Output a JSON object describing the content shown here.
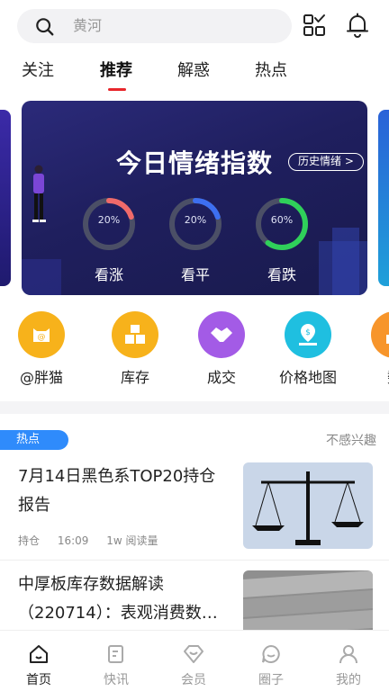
{
  "search": {
    "placeholder": "黄河"
  },
  "tabs": [
    {
      "label": "关注"
    },
    {
      "label": "推荐",
      "active": true
    },
    {
      "label": "解惑"
    },
    {
      "label": "热点"
    }
  ],
  "banner": {
    "title": "今日情绪指数",
    "history_button": "历史情绪 >",
    "gauges": [
      {
        "label": "看涨",
        "value": "20%",
        "fraction": 0.2,
        "color": "#f06a6a"
      },
      {
        "label": "看平",
        "value": "20%",
        "fraction": 0.2,
        "color": "#3d6ff0"
      },
      {
        "label": "看跌",
        "value": "60%",
        "fraction": 0.6,
        "color": "#2fd05a"
      }
    ]
  },
  "quick_links": [
    {
      "label": "@胖猫",
      "icon": "cat-icon",
      "color": "#f7b21b"
    },
    {
      "label": "库存",
      "icon": "boxes-icon",
      "color": "#f7b21b"
    },
    {
      "label": "成交",
      "icon": "handshake-icon",
      "color": "#a35be6"
    },
    {
      "label": "价格地图",
      "icon": "map-pin-icon",
      "color": "#1fbfe0"
    },
    {
      "label": "数",
      "icon": "data-icon",
      "color": "#f7952b"
    }
  ],
  "feed": {
    "section_tag": "热点",
    "not_interested": "不感兴趣",
    "articles": [
      {
        "title": "7月14日黑色系TOP20持仓报告",
        "tag": "持仓",
        "time": "16:09",
        "reads": "1w 阅读量"
      },
      {
        "title": "中厚板库存数据解读（220714）：表观消费数…"
      }
    ]
  },
  "bottom_nav": [
    {
      "label": "首页",
      "icon": "home-icon",
      "active": true
    },
    {
      "label": "快讯",
      "icon": "news-icon"
    },
    {
      "label": "会员",
      "icon": "member-icon"
    },
    {
      "label": "圈子",
      "icon": "circle-chat-icon"
    },
    {
      "label": "我的",
      "icon": "profile-icon"
    }
  ],
  "colors": {
    "accent": "#e8262b",
    "tag_blue": "#2f8bfb"
  }
}
